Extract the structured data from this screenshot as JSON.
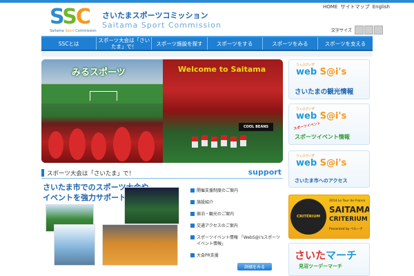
{
  "logo": {
    "mark": [
      "S",
      "S",
      "C"
    ],
    "sub_prefix": "Saitama",
    "sub_highlight": "Sport",
    "sub_suffix": "Commission",
    "jp_title": "さいたまスポーツコミッション",
    "en_title": "Saitama Sport Commission"
  },
  "utility": {
    "links": [
      "HOME",
      "サイトマップ",
      "English"
    ],
    "font_size_label": "文字サイズ"
  },
  "global_nav": [
    {
      "label": "SSCとは"
    },
    {
      "label": "スポーツ大会は「さいたま」で！"
    },
    {
      "label": "スポーツ施設を探す"
    },
    {
      "label": "スポーツをする"
    },
    {
      "label": "スポーツをみる"
    },
    {
      "label": "スポーツを支える"
    }
  ],
  "hero": {
    "left_caption": "みるスポーツ",
    "right_caption": "Welcome to Saitama",
    "banner_text": "COOL BEANS"
  },
  "support": {
    "section_title": "スポーツ大会は「さいたま」で！",
    "section_en": "support",
    "copy_line1": "さいたま市でのスポーツ大会や",
    "copy_line2": "イベントを強力サポート！",
    "list": [
      "開催支援制度のご案内",
      "施設紹介",
      "宿泊・観光のご案内",
      "交通アクセスのご案内",
      "スポーツイベント情報 「WebS@i'sスポーツイベント情報」",
      "大会PR支援"
    ],
    "detail_button": "詳細をみる"
  },
  "sidebar": {
    "websais_small": "うぇぶさいず",
    "websais_w": "web",
    "websais_s": "S@i's",
    "banner1_title": "さいたまの観光情報",
    "banner2_sub": "スポーツイベント",
    "banner2_title": "スポーツイベント情報",
    "banner3_title": "さいたま市へのアクセス",
    "criterium": {
      "circle": "CRITÉRIUM",
      "top": "2014 Le Tour de France",
      "saitama": "SAITAMA",
      "word": "CRITERIUM",
      "presented_by": "Presented by ベルーナ"
    },
    "march": {
      "title_a": "さいた",
      "title_b": "マーチ",
      "subtitle": "見沼ツーデーマーチ"
    }
  },
  "colors": {
    "nav_blue": "#1f7fd2",
    "brand_blue": "#1d63b0",
    "accent_orange": "#f39a1e",
    "accent_green": "#6fb62b",
    "criterium_yellow": "#f6c21a"
  }
}
